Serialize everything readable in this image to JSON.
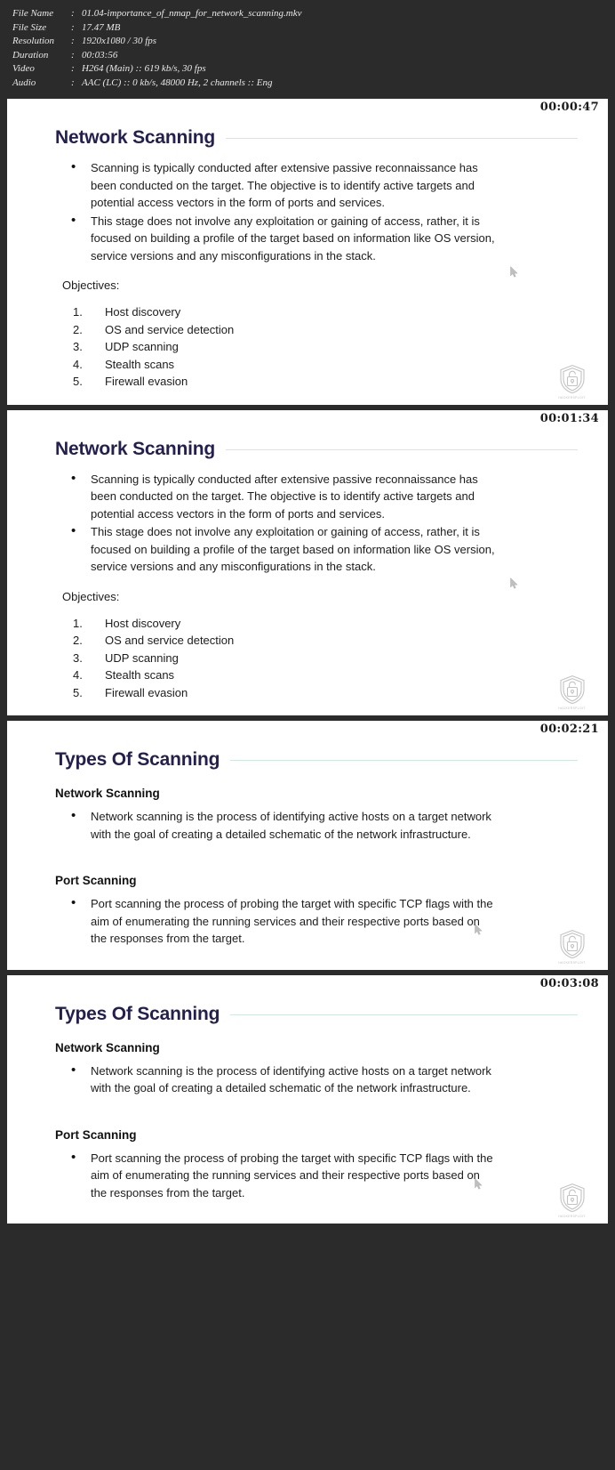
{
  "mediainfo": {
    "rows": [
      {
        "label": "File Name",
        "value": "01.04-importance_of_nmap_for_network_scanning.mkv"
      },
      {
        "label": "File Size",
        "value": "17.47 MB"
      },
      {
        "label": "Resolution",
        "value": "1920x1080 / 30 fps"
      },
      {
        "label": "Duration",
        "value": "00:03:56"
      },
      {
        "label": "Video",
        "value": "H264 (Main) :: 619 kb/s, 30 fps"
      },
      {
        "label": "Audio",
        "value": "AAC (LC) :: 0 kb/s, 48000 Hz, 2 channels :: Eng"
      }
    ],
    "separator": ":"
  },
  "colors": {
    "background": "#2b2b2b",
    "title": "#231f4e",
    "rule": "#cfe9dd",
    "body_text": "#1c1c1c",
    "watermark": "#b7b7b7"
  },
  "watermark": {
    "brand": "HACKERSPLOIT.",
    "icon": "shield-padlock-icon"
  },
  "frames": [
    {
      "timestamp": "00:00:47",
      "title": "Network Scanning",
      "bullets": [
        "Scanning is typically conducted after extensive passive reconnaissance has been conducted on the target. The objective is to identify active targets and potential access vectors in the form of ports and services.",
        "This stage does not involve any exploitation or gaining of access, rather, it is focused on building a profile of the target based on information like OS version, service versions and any misconfigurations in the stack."
      ],
      "lead": "Objectives:",
      "numbered": [
        "Host discovery",
        "OS and service detection",
        "UDP scanning",
        "Stealth scans",
        "Firewall evasion"
      ]
    },
    {
      "timestamp": "00:01:34",
      "title": "Network Scanning",
      "bullets": [
        "Scanning is typically conducted after extensive passive reconnaissance has been conducted on the target. The objective is to identify active targets and potential access vectors in the form of ports and services.",
        "This stage does not involve any exploitation or gaining of access, rather, it is focused on building a profile of the target based on information like OS version, service versions and any misconfigurations in the stack."
      ],
      "lead": "Objectives:",
      "numbered": [
        "Host discovery",
        "OS and service detection",
        "UDP scanning",
        "Stealth scans",
        "Firewall evasion"
      ]
    },
    {
      "timestamp": "00:02:21",
      "title": "Types Of Scanning",
      "sections": [
        {
          "heading": "Network Scanning",
          "bullets": [
            "Network scanning is the process of identifying active hosts on a target network with the goal of creating a detailed schematic of the network infrastructure."
          ]
        },
        {
          "heading": "Port Scanning",
          "bullets": [
            "Port scanning the process of probing the target with specific TCP flags with the aim of enumerating the running services and their respective ports based on the responses from the target."
          ]
        }
      ]
    },
    {
      "timestamp": "00:03:08",
      "title": "Types Of Scanning",
      "sections": [
        {
          "heading": "Network Scanning",
          "bullets": [
            "Network scanning is the process of identifying active hosts on a target network with the goal of creating a detailed schematic of the network infrastructure."
          ]
        },
        {
          "heading": "Port Scanning",
          "bullets": [
            "Port scanning the process of probing the target with specific TCP flags with the aim of enumerating the running services and their respective ports based on the responses from the target."
          ]
        }
      ]
    }
  ]
}
